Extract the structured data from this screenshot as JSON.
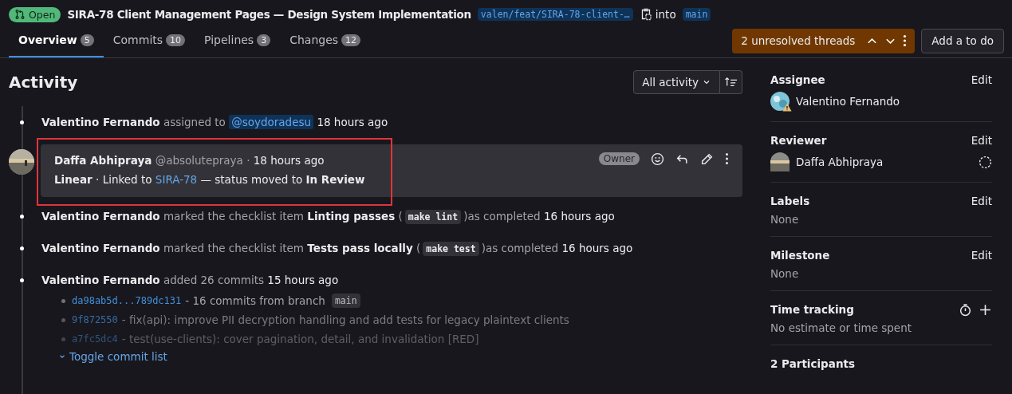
{
  "header": {
    "status": "Open",
    "title": "SIRA-78 Client Management Pages — Design System Implementation",
    "source_branch": "valen/feat/SIRA-78-client-…",
    "into": "into",
    "target_branch": "main"
  },
  "tabs": [
    {
      "label": "Overview",
      "count": "5",
      "selected": true
    },
    {
      "label": "Commits",
      "count": "10",
      "selected": false
    },
    {
      "label": "Pipelines",
      "count": "3",
      "selected": false
    },
    {
      "label": "Changes",
      "count": "12",
      "selected": false
    }
  ],
  "threads": {
    "label": "2 unresolved threads"
  },
  "todo_button": "Add a to do",
  "activity": {
    "title": "Activity",
    "filter": "All activity",
    "items": [
      {
        "kind": "event",
        "parts": [
          {
            "kind": "bold",
            "text": "Valentino Fernando"
          },
          {
            "kind": "muted",
            "text": "assigned to"
          },
          {
            "kind": "mention",
            "text": "@soydoradesu"
          },
          {
            "kind": "time",
            "text": "18 hours ago"
          }
        ]
      },
      {
        "kind": "note",
        "highlighted": true,
        "author": "Daffa Abhipraya",
        "handle": "@absolutepraya · ",
        "time": "18 hours ago",
        "badge": "Owner",
        "body_before": "**Linear** · Linked to",
        "link": "SIRA-78",
        "body_after": "— status moved to **In Review**"
      },
      {
        "kind": "event",
        "parts": [
          {
            "kind": "bold",
            "text": "Valentino Fernando"
          },
          {
            "kind": "muted",
            "text": "marked the checklist item"
          },
          {
            "kind": "bold",
            "text": "Linting passes"
          },
          {
            "kind": "paren",
            "text": "("
          },
          {
            "kind": "code",
            "text": "make lint"
          },
          {
            "kind": "paren",
            "text": ")"
          },
          {
            "kind": "muted",
            "text": "as completed"
          },
          {
            "kind": "time",
            "text": "16 hours ago"
          }
        ]
      },
      {
        "kind": "event",
        "parts": [
          {
            "kind": "bold",
            "text": "Valentino Fernando"
          },
          {
            "kind": "muted",
            "text": "marked the checklist item"
          },
          {
            "kind": "bold",
            "text": "Tests pass locally"
          },
          {
            "kind": "paren",
            "text": "("
          },
          {
            "kind": "code",
            "text": "make test"
          },
          {
            "kind": "paren",
            "text": ")"
          },
          {
            "kind": "muted",
            "text": "as completed"
          },
          {
            "kind": "time",
            "text": "16 hours ago"
          }
        ]
      },
      {
        "kind": "commits",
        "parts": [
          {
            "kind": "bold",
            "text": "Valentino Fernando"
          },
          {
            "kind": "muted",
            "text": "added 26 commits"
          },
          {
            "kind": "time",
            "text": "15 hours ago"
          }
        ],
        "commits": [
          {
            "hash": "da98ab5d...789dc131",
            "text": "- 16 commits from branch",
            "branch": "main"
          },
          {
            "hash": "9f872550",
            "text": "- fix(api): improve PII decryption handling and add tests for legacy plaintext clients"
          },
          {
            "hash": "a7fc5dc4",
            "text": "- test(use-clients): cover pagination, detail, and invalidation [RED]"
          }
        ],
        "toggle": "Toggle commit list"
      }
    ]
  },
  "sidebar": [
    {
      "kind": "person",
      "title": "Assignee",
      "action": "Edit",
      "name": "Valentino Fernando",
      "warning": true,
      "pending": false
    },
    {
      "kind": "person",
      "title": "Reviewer",
      "action": "Edit",
      "name": "Daffa Abhipraya",
      "warning": false,
      "pending": true
    },
    {
      "kind": "text",
      "title": "Labels",
      "action": "Edit",
      "value": "None"
    },
    {
      "kind": "text",
      "title": "Milestone",
      "action": "Edit",
      "value": "None"
    },
    {
      "kind": "time",
      "title": "Time tracking",
      "value": "No estimate or time spent"
    },
    {
      "kind": "heading",
      "title": "2 Participants"
    }
  ]
}
